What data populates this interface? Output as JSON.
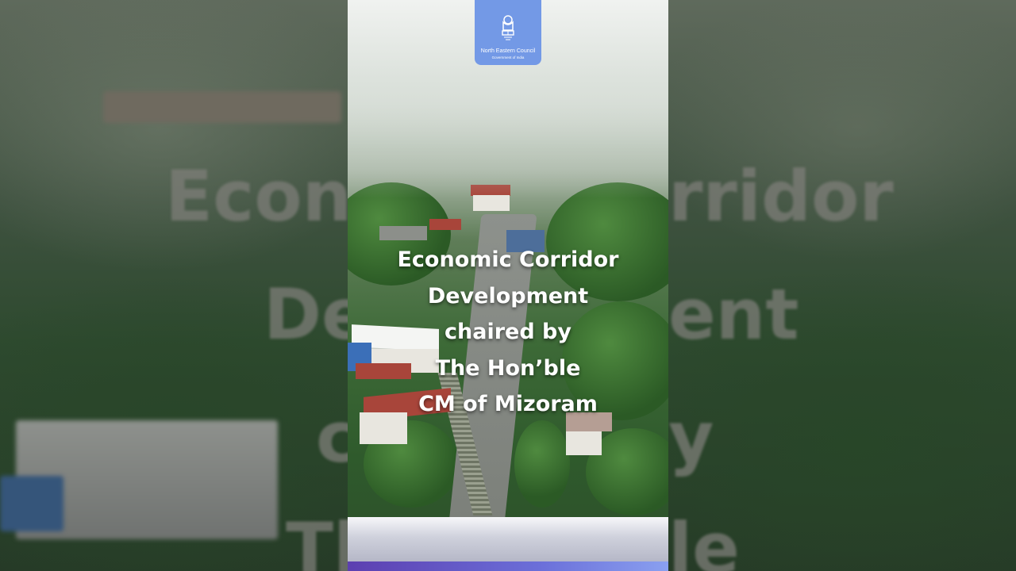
{
  "logo": {
    "name": "North Eastern Council",
    "subtitle": "Government of India",
    "icon": "national-emblem-icon"
  },
  "caption": {
    "lines": [
      "Economic Corridor",
      "Development",
      "chaired by",
      "The Hon’ble",
      "CM of Mizoram"
    ]
  },
  "background_echo": {
    "lines": [
      "Econ",
      "rridor",
      "De",
      "ent",
      "c",
      "y",
      "Th",
      "le"
    ]
  },
  "colors": {
    "logo_badge": "#7399e6",
    "bottom_bar": "#6b6fd9"
  }
}
